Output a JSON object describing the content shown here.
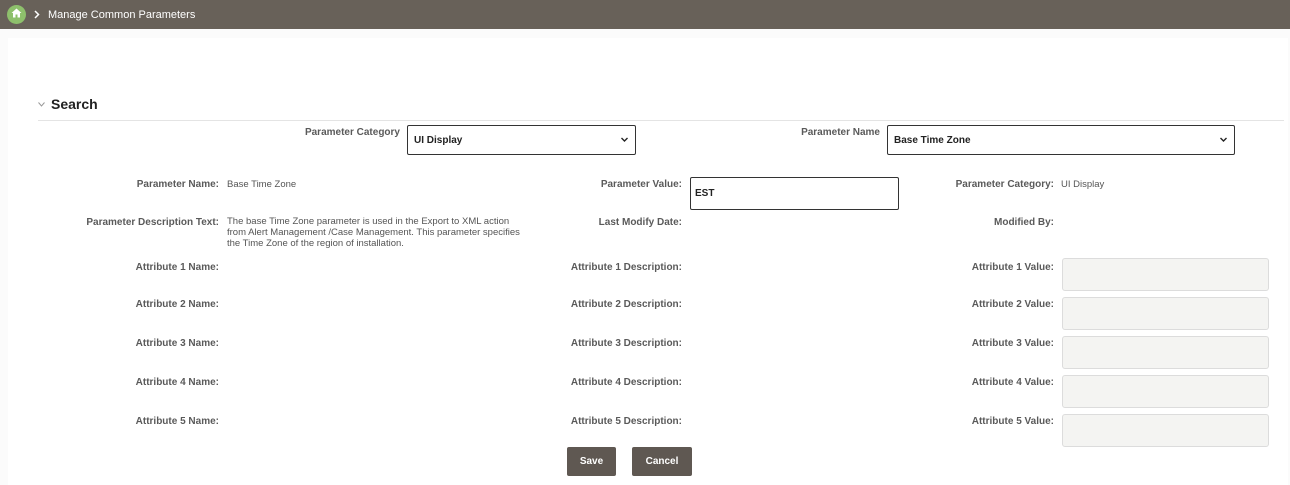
{
  "breadcrumb": {
    "current": "Manage Common Parameters"
  },
  "section": {
    "title": "Search"
  },
  "filters": {
    "category_label": "Parameter Category",
    "category_value": "UI Display",
    "name_label": "Parameter Name",
    "name_value": "Base Time Zone"
  },
  "details": {
    "param_name_label": "Parameter Name:",
    "param_name_value": "Base Time Zone",
    "param_value_label": "Parameter Value:",
    "param_value_value": "EST",
    "param_category_label": "Parameter Category:",
    "param_category_value": "UI Display",
    "description_label": "Parameter Description Text:",
    "description_value": "The base Time Zone parameter is used in the Export to XML action from Alert Management /Case Management. This parameter specifies the Time Zone of the region of installation.",
    "last_modify_label": "Last Modify Date:",
    "modified_by_label": "Modified By:"
  },
  "attributes": [
    {
      "name_label": "Attribute 1 Name:",
      "desc_label": "Attribute 1 Description:",
      "value_label": "Attribute 1 Value:"
    },
    {
      "name_label": "Attribute 2 Name:",
      "desc_label": "Attribute 2 Description:",
      "value_label": "Attribute 2 Value:"
    },
    {
      "name_label": "Attribute 3 Name:",
      "desc_label": "Attribute 3 Description:",
      "value_label": "Attribute 3 Value:"
    },
    {
      "name_label": "Attribute 4 Name:",
      "desc_label": "Attribute 4 Description:",
      "value_label": "Attribute 4 Value:"
    },
    {
      "name_label": "Attribute 5 Name:",
      "desc_label": "Attribute 5 Description:",
      "value_label": "Attribute 5 Value:"
    }
  ],
  "buttons": {
    "save": "Save",
    "cancel": "Cancel"
  },
  "icons": {
    "home": "home-icon",
    "breadcrumb_separator": "chevron-right-icon",
    "section_toggle": "chevron-down-icon",
    "select_arrow": "chevron-down-icon"
  },
  "colors": {
    "topbar": "#686159",
    "home_button": "#8ec06c",
    "button": "#5f5852"
  }
}
